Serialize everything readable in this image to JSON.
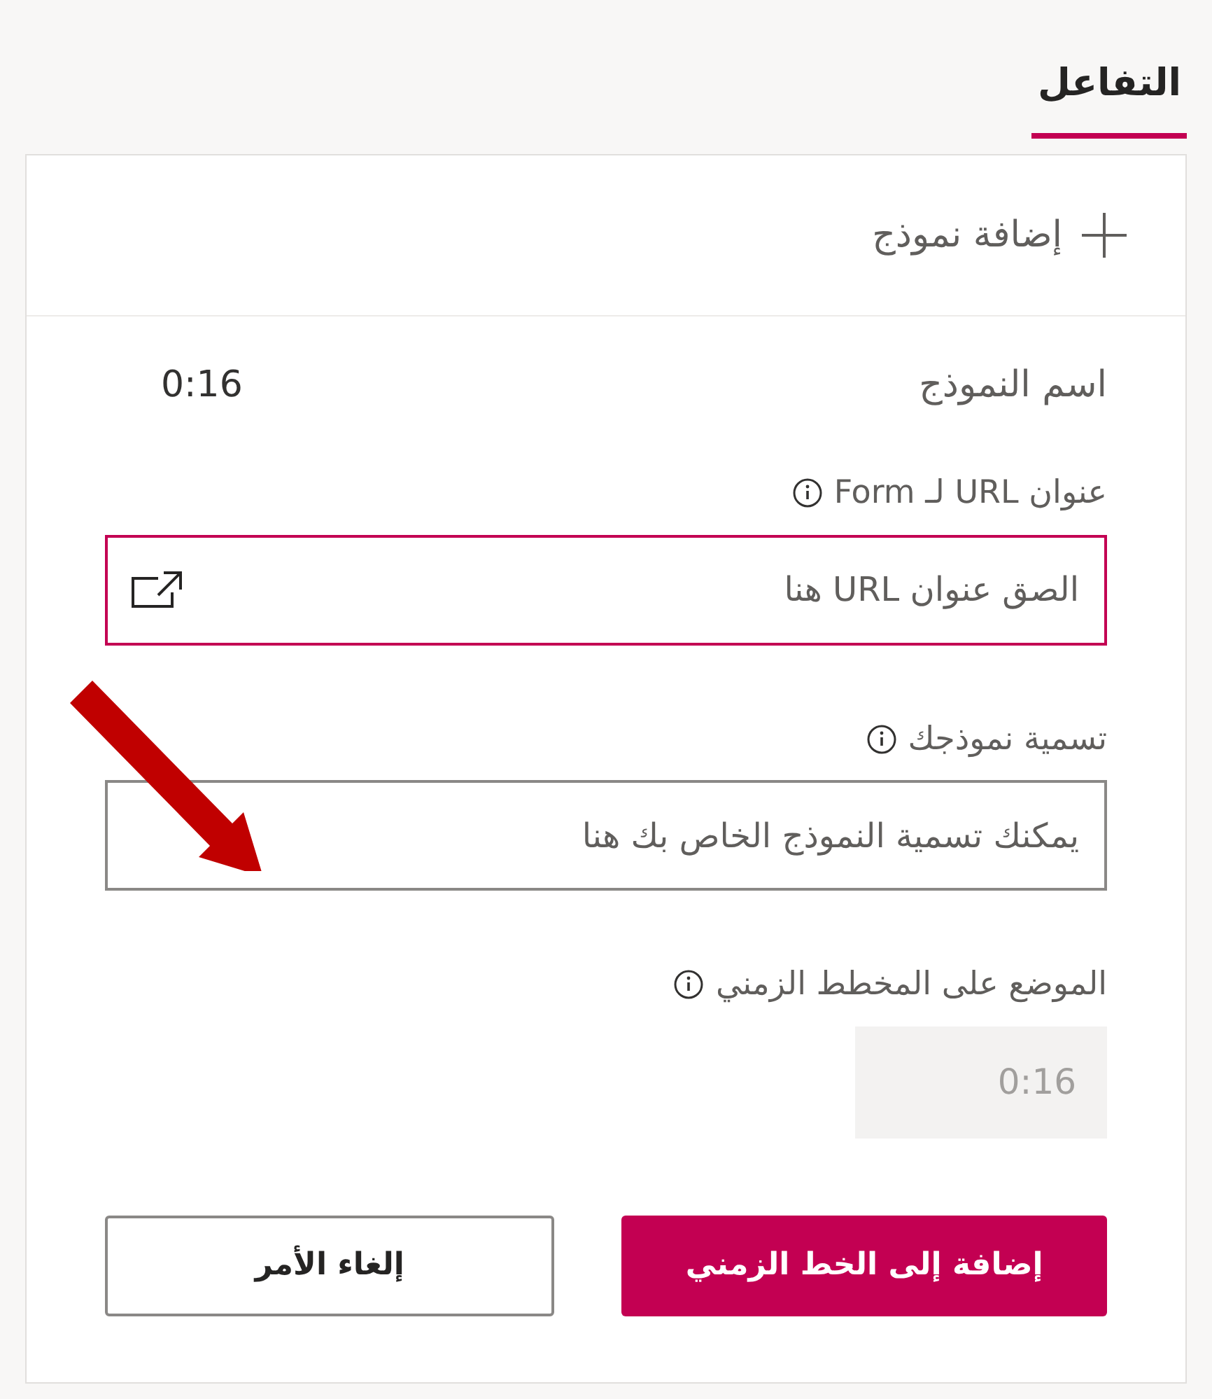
{
  "tabs": [
    {
      "label": "التفاعل",
      "selected": true
    }
  ],
  "add_form": {
    "label": "إضافة نموذج"
  },
  "form_header": {
    "name": "اسم النموذج",
    "time": "0:16"
  },
  "fields": [
    {
      "label": "عنوان URL لـ Form",
      "placeholder": "الصق عنوان URL هنا",
      "focused": true,
      "kind": "url"
    },
    {
      "label": "تسمية نموذجك",
      "placeholder": "يمكنك تسمية النموذج الخاص بك هنا",
      "focused": false,
      "kind": "text"
    },
    {
      "label": "الموضع على المخطط الزمني",
      "value": "0:16",
      "disabled": true,
      "kind": "time"
    }
  ],
  "buttons": [
    {
      "label": "إضافة إلى الخط الزمني",
      "kind": "primary"
    },
    {
      "label": "إلغاء الأمر",
      "kind": "secondary"
    }
  ]
}
